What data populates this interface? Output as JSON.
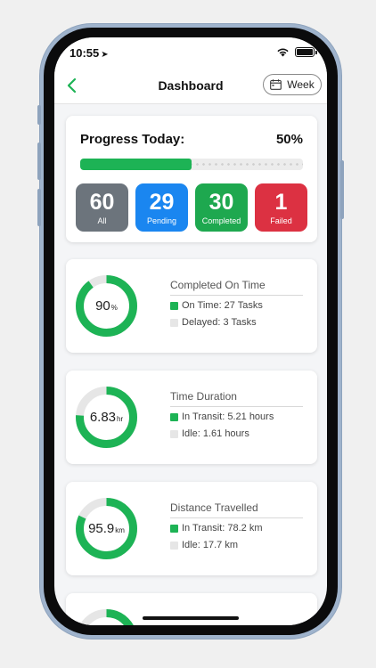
{
  "status": {
    "time": "10:55"
  },
  "nav": {
    "title": "Dashboard",
    "week_label": "Week"
  },
  "progress": {
    "title": "Progress Today:",
    "percent_label": "50%",
    "fraction": 0.5,
    "fill_color": "#1db355"
  },
  "stats": [
    {
      "value": "60",
      "label": "All",
      "color": "#6c747c"
    },
    {
      "value": "29",
      "label": "Pending",
      "color": "#1a86f0"
    },
    {
      "value": "30",
      "label": "Completed",
      "color": "#1ea84f"
    },
    {
      "value": "1",
      "label": "Failed",
      "color": "#dc3142"
    }
  ],
  "metrics": [
    {
      "title": "Completed On Time",
      "value": "90",
      "unit": "%",
      "fraction": 0.9,
      "legend": [
        {
          "text": "On Time: 27 Tasks",
          "color": "#1db355"
        },
        {
          "text": "Delayed: 3 Tasks",
          "color": "#e6e6e6"
        }
      ]
    },
    {
      "title": "Time Duration",
      "value": "6.83",
      "unit": "hr",
      "fraction": 0.76,
      "legend": [
        {
          "text": "In Transit: 5.21 hours",
          "color": "#1db355"
        },
        {
          "text": "Idle: 1.61 hours",
          "color": "#e6e6e6"
        }
      ]
    },
    {
      "title": "Distance Travelled",
      "value": "95.9",
      "unit": "km",
      "fraction": 0.82,
      "legend": [
        {
          "text": "In Transit: 78.2 km",
          "color": "#1db355"
        },
        {
          "text": "Idle: 17.7 km",
          "color": "#e6e6e6"
        }
      ]
    },
    {
      "title": "",
      "value": "",
      "unit": "",
      "fraction": 0.3,
      "legend": []
    }
  ],
  "colors": {
    "accent": "#1db355",
    "ring_track": "#e6e6e6"
  }
}
